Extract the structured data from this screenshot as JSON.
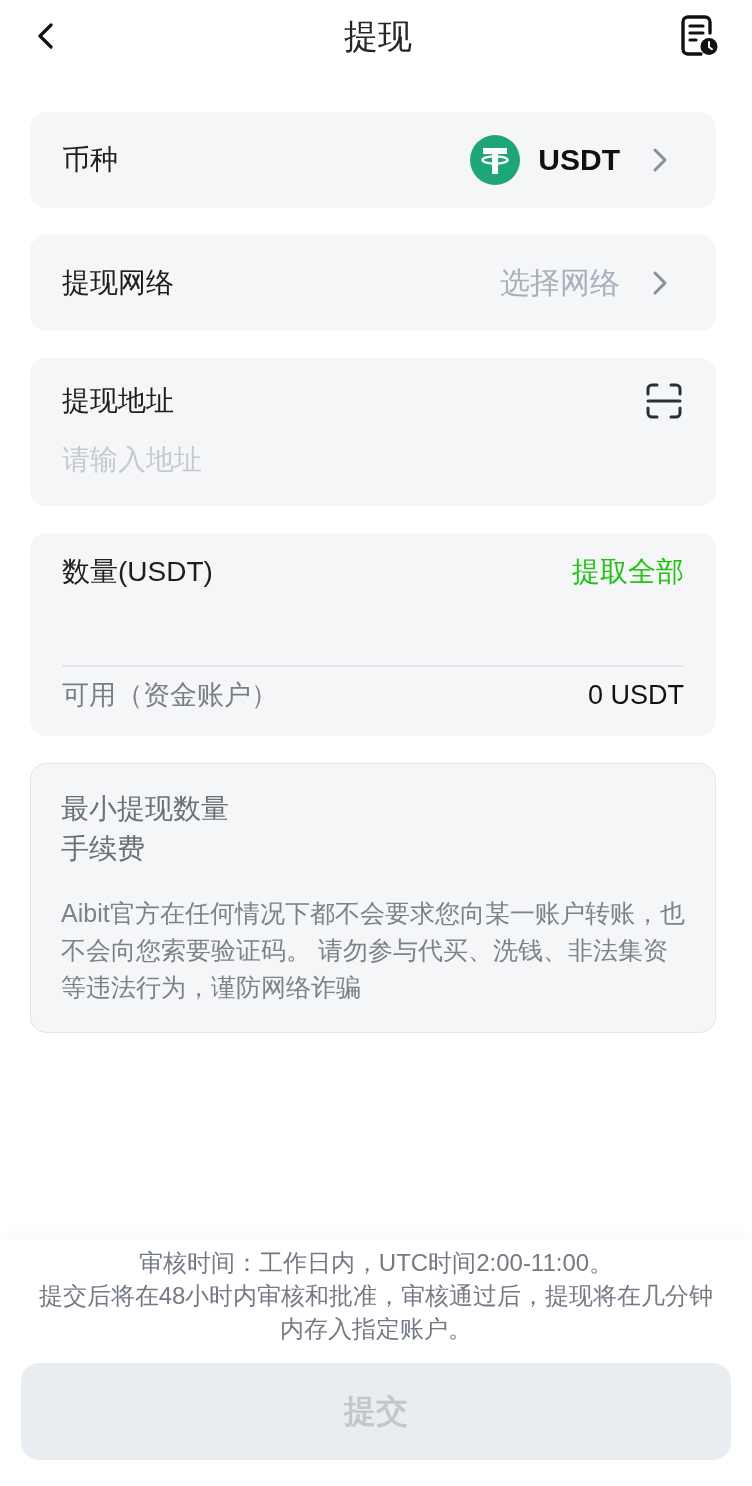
{
  "header": {
    "title": "提现"
  },
  "coin": {
    "label": "币种",
    "value": "USDT"
  },
  "network": {
    "label": "提现网络",
    "placeholder": "选择网络"
  },
  "address": {
    "label": "提现地址",
    "placeholder": "请输入地址"
  },
  "amount": {
    "label": "数量(USDT)",
    "action": "提取全部",
    "available_label": "可用（资金账户）",
    "available_value": "0 USDT"
  },
  "info": {
    "lines": [
      "最小提现数量",
      "手续费"
    ],
    "notice": "Aibit官方在任何情况下都不会要求您向某一账户转账，也不会向您索要验证码。 请勿参与代买、洗钱、非法集资等违法行为，谨防网络诈骗"
  },
  "footer": {
    "notice_lines": [
      "审核时间：工作日内，UTC时间2:00-11:00。",
      "提交后将在48小时内审核和批准，审核通过后，提现将在几分钟内存入指定账户。"
    ],
    "submit": {
      "label": "提交",
      "disabled": true
    }
  }
}
